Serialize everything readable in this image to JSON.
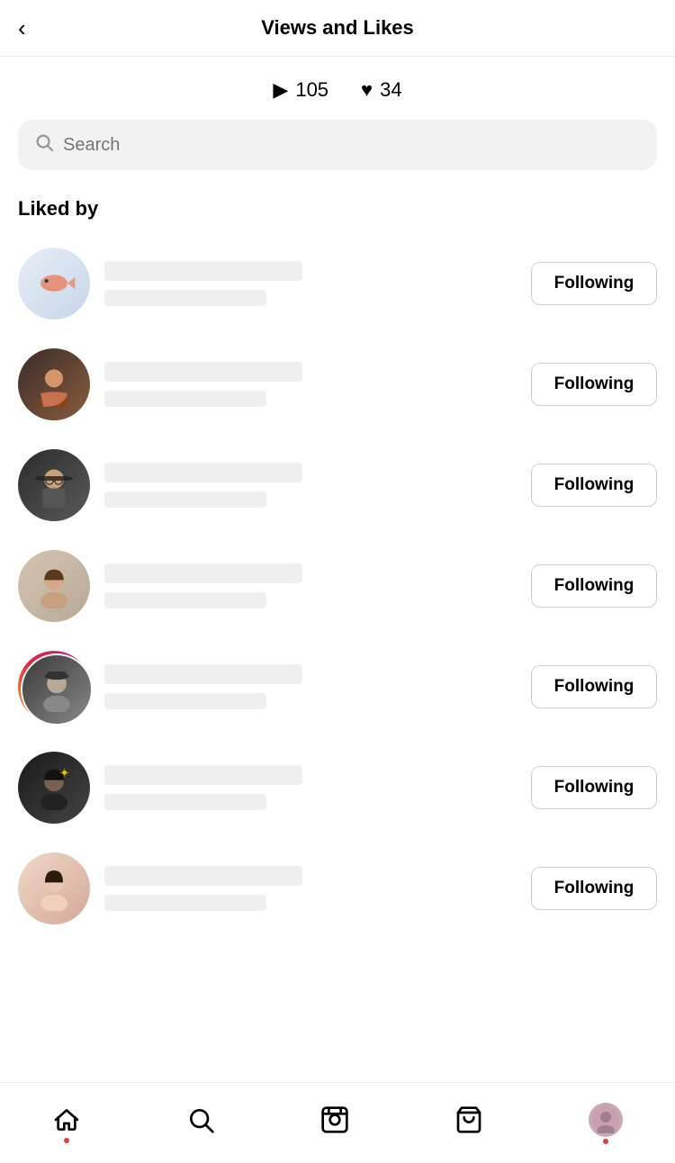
{
  "header": {
    "back_label": "‹",
    "title": "Views and Likes"
  },
  "stats": {
    "views_icon": "▶",
    "views_count": "105",
    "likes_icon": "♥",
    "likes_count": "34"
  },
  "search": {
    "placeholder": "Search"
  },
  "section": {
    "liked_by_label": "Liked by"
  },
  "users": [
    {
      "id": 1,
      "following_label": "Following",
      "has_story_ring": false,
      "av_class": "av-bg-1",
      "av_type": "fish"
    },
    {
      "id": 2,
      "following_label": "Following",
      "has_story_ring": false,
      "av_class": "av-bg-2",
      "av_type": "person"
    },
    {
      "id": 3,
      "following_label": "Following",
      "has_story_ring": false,
      "av_class": "av-bg-3",
      "av_type": "person"
    },
    {
      "id": 4,
      "following_label": "Following",
      "has_story_ring": false,
      "av_class": "av-bg-4",
      "av_type": "person"
    },
    {
      "id": 5,
      "following_label": "Following",
      "has_story_ring": true,
      "av_class": "av-bg-5",
      "av_type": "person"
    },
    {
      "id": 6,
      "following_label": "Following",
      "has_story_ring": false,
      "av_class": "av-bg-6",
      "av_type": "person"
    },
    {
      "id": 7,
      "following_label": "Following",
      "has_story_ring": false,
      "av_class": "av-bg-7",
      "av_type": "person"
    }
  ],
  "nav": {
    "home_icon": "⌂",
    "search_icon": "⚲",
    "reels_icon": "▣",
    "shop_icon": "⊠",
    "profile_dot": true,
    "home_dot": true
  }
}
